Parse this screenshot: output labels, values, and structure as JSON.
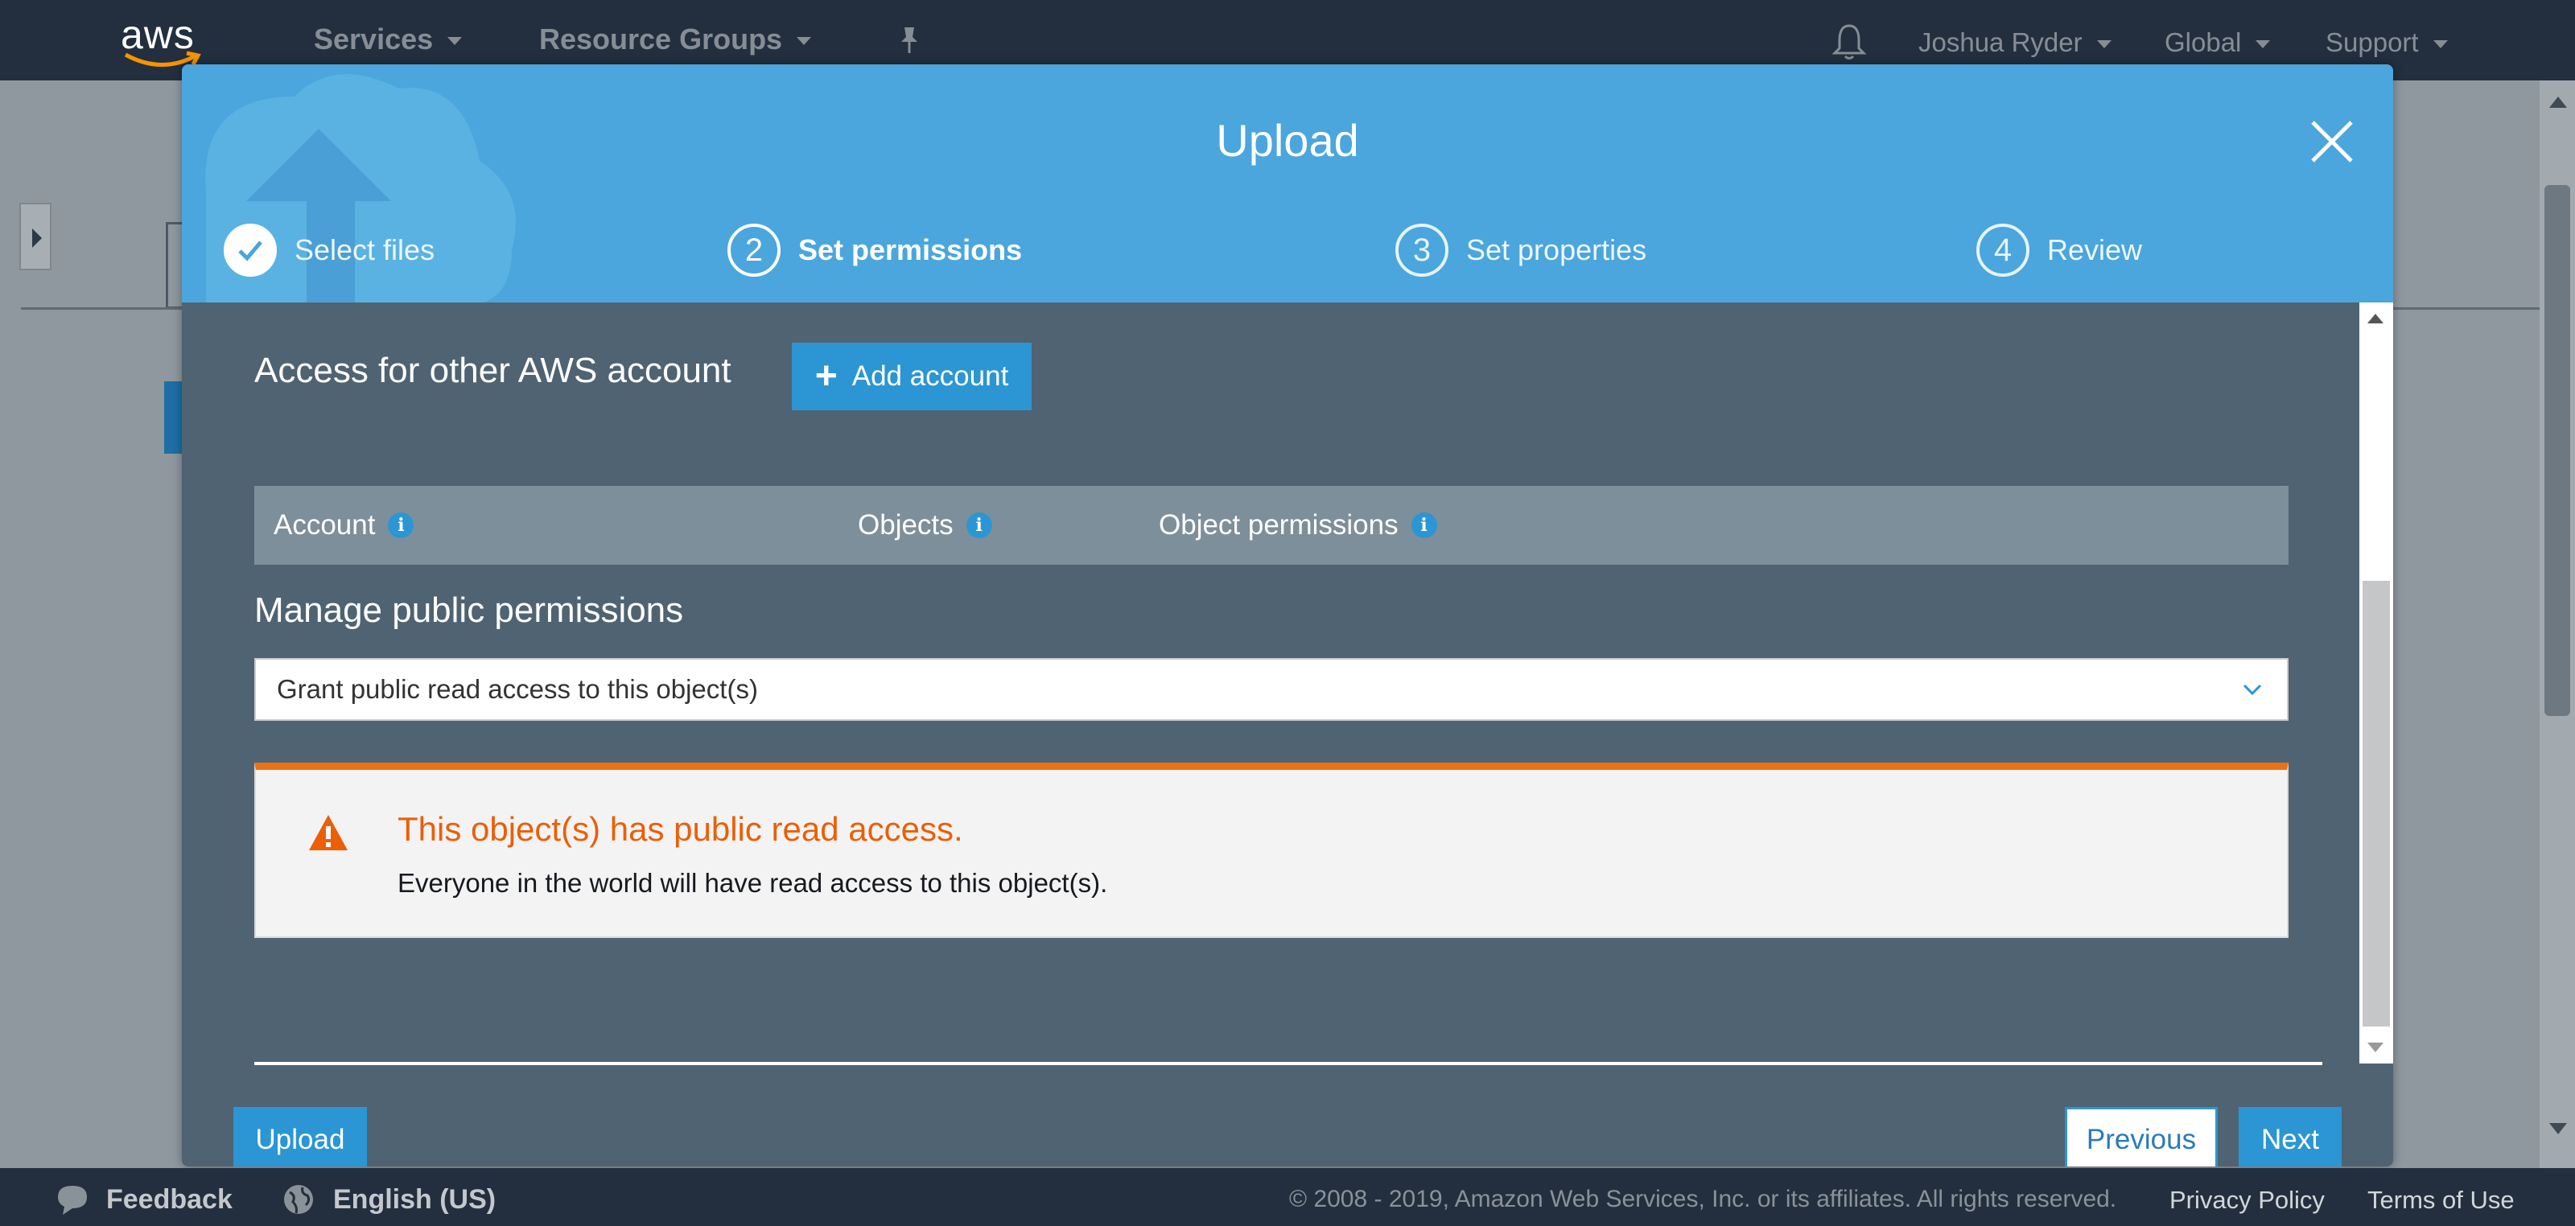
{
  "topnav": {
    "logo_text": "aws",
    "services": "Services",
    "resource_groups": "Resource Groups",
    "user": "Joshua Ryder",
    "region": "Global",
    "support": "Support"
  },
  "modal": {
    "title": "Upload",
    "steps": [
      {
        "number": "",
        "label": "Select files",
        "state": "done"
      },
      {
        "number": "2",
        "label": "Set permissions",
        "state": "current"
      },
      {
        "number": "3",
        "label": "Set properties",
        "state": "pending"
      },
      {
        "number": "4",
        "label": "Review",
        "state": "pending"
      }
    ],
    "other_accounts_title": "Access for other AWS account",
    "add_account_label": "Add account",
    "table_headers": {
      "account": "Account",
      "objects": "Objects",
      "object_permissions": "Object permissions"
    },
    "public_permissions_title": "Manage public permissions",
    "public_select_value": "Grant public read access to this object(s)",
    "alert": {
      "title": "This object(s) has public read access.",
      "text": "Everyone in the world will have read access to this object(s)."
    },
    "buttons": {
      "upload": "Upload",
      "previous": "Previous",
      "next": "Next"
    }
  },
  "footer": {
    "feedback": "Feedback",
    "language": "English (US)",
    "copyright": "© 2008 - 2019, Amazon Web Services, Inc. or its affiliates. All rights reserved.",
    "privacy": "Privacy Policy",
    "terms": "Terms of Use"
  },
  "colors": {
    "header_blue": "#4aa6dd",
    "primary_button": "#2b96d3",
    "alert_orange": "#ec7211",
    "modal_body": "#4f6372"
  }
}
